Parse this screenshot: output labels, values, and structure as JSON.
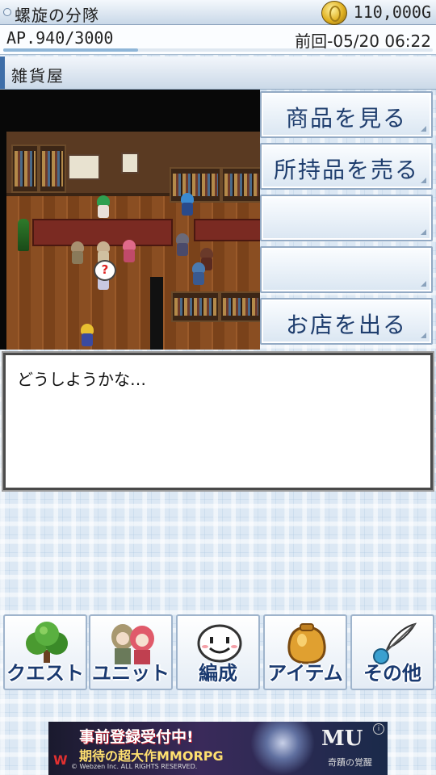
{
  "header": {
    "game_title": "螺旋の分隊",
    "gold": "110,000G",
    "ap_text": "AP.940/3000",
    "ap_ratio": 0.313,
    "last_time": "前回-05/20 06:22"
  },
  "location": {
    "name": "雑貨屋"
  },
  "menu": [
    {
      "label": "商品を見る"
    },
    {
      "label": "所持品を売る"
    },
    {
      "label": ""
    },
    {
      "label": ""
    },
    {
      "label": "お店を出る"
    }
  ],
  "dialog": {
    "message": "どうしようかな…"
  },
  "nav": [
    {
      "label": "クエスト",
      "icon": "tree-icon"
    },
    {
      "label": "ユニット",
      "icon": "characters-icon"
    },
    {
      "label": "編成",
      "icon": "face-icon"
    },
    {
      "label": "アイテム",
      "icon": "bag-icon"
    },
    {
      "label": "その他",
      "icon": "quill-icon"
    }
  ],
  "ad": {
    "line1": "事前登録受付中!",
    "line2": "期待の超大作MMORPG",
    "line3": "© Webzen Inc. ALL RIGHTS RESERVED.",
    "brand": "MU",
    "brand_sub": "奇蹟の覚醒",
    "info": "i",
    "maker": "W"
  }
}
